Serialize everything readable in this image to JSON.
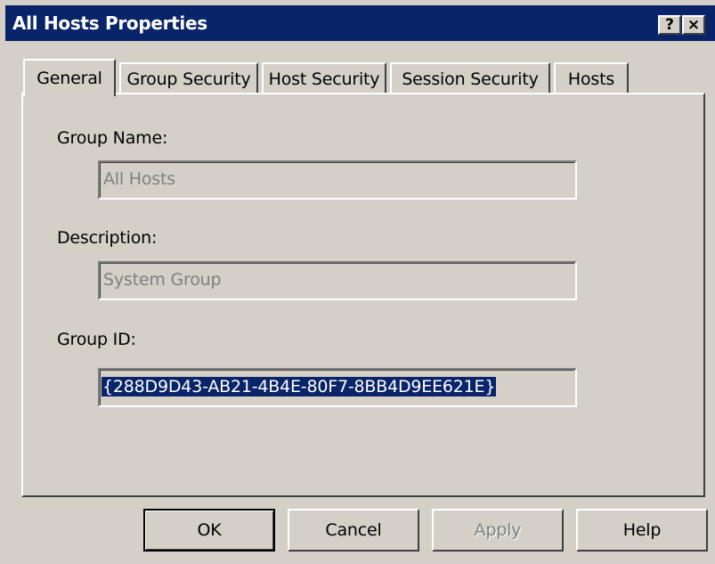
{
  "window": {
    "title": "All Hosts Properties",
    "help_button": "?",
    "close_button": "×"
  },
  "tabs": [
    {
      "label": "General",
      "active": true
    },
    {
      "label": "Group Security",
      "active": false
    },
    {
      "label": "Host Security",
      "active": false
    },
    {
      "label": "Session Security",
      "active": false
    },
    {
      "label": "Hosts",
      "active": false
    }
  ],
  "form": {
    "group_name_label": "Group Name:",
    "group_name_value": "All Hosts",
    "description_label": "Description:",
    "description_value": "System Group",
    "group_id_label": "Group ID:",
    "group_id_value": "{288D9D43-AB21-4B4E-80F7-8BB4D9EE621E}"
  },
  "buttons": {
    "ok": "OK",
    "cancel": "Cancel",
    "apply": "Apply",
    "help": "Help"
  },
  "colors": {
    "titlebar": "#0a246a",
    "face": "#d4d0c8",
    "selection": "#0a246a"
  }
}
